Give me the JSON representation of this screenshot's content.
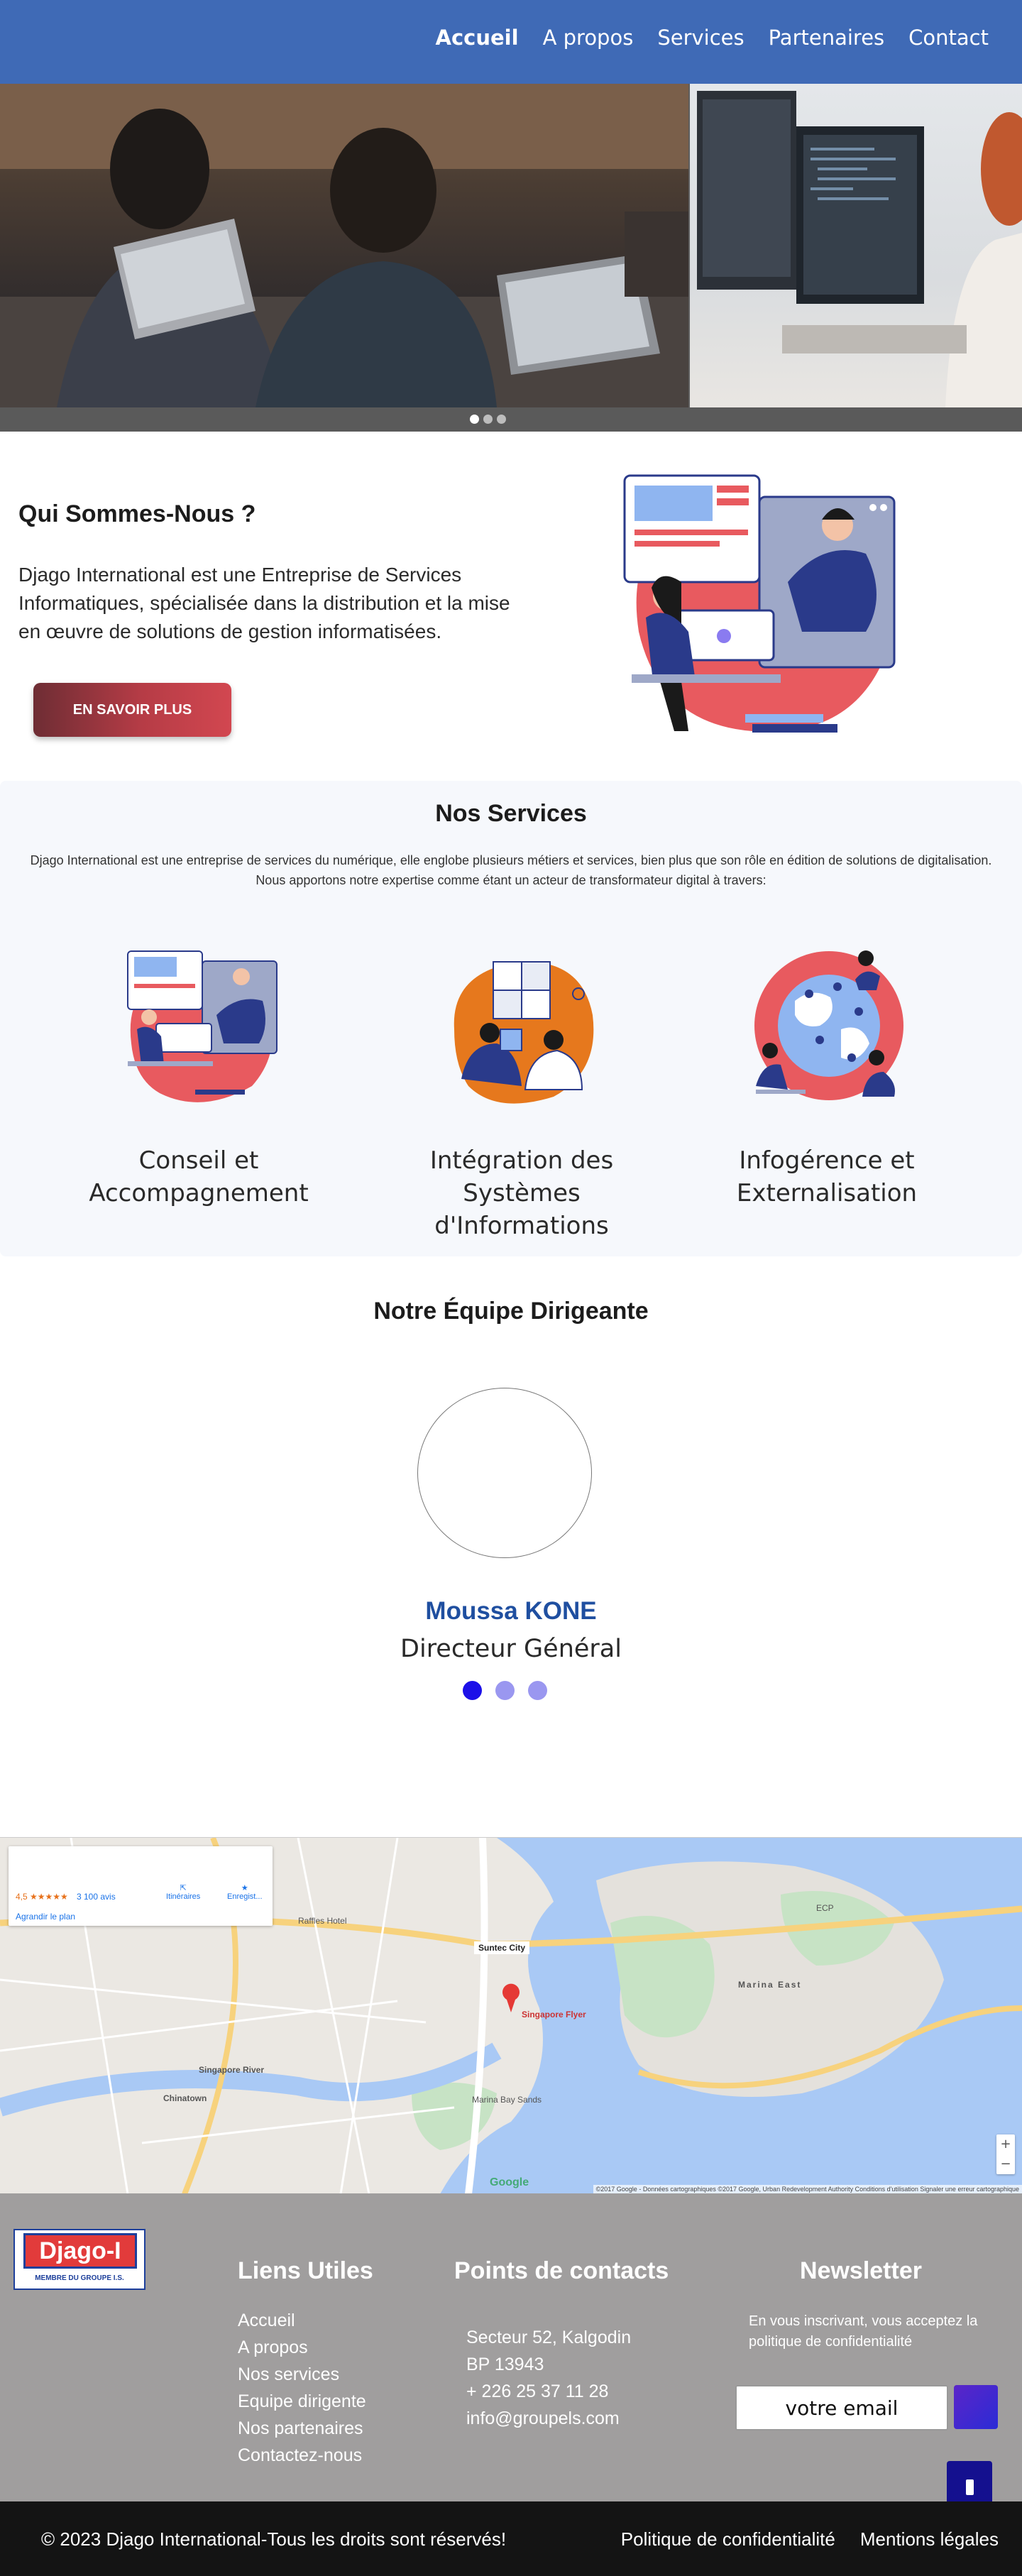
{
  "nav": {
    "items": [
      {
        "label": "Accueil",
        "active": true
      },
      {
        "label": "A propos",
        "active": false
      },
      {
        "label": "Services",
        "active": false
      },
      {
        "label": "Partenaires",
        "active": false
      },
      {
        "label": "Contact",
        "active": false
      }
    ],
    "bg_color": "#3f6ab6"
  },
  "hero": {
    "slide_count": 3,
    "active_slide": 1
  },
  "about": {
    "title": "Qui Sommes-Nous ?",
    "text": "Djago International est une Entreprise de Services Informatiques, spécialisée dans la distribution et la mise en œuvre de solutions de gestion informatisées.",
    "button_label": "EN SAVOIR PLUS"
  },
  "services": {
    "title": "Nos Services",
    "text": "Djago International est une entreprise de services du numérique, elle englobe plusieurs métiers et services, bien plus que son rôle en édition de solutions de digitalisation. Nous apportons notre expertise comme étant un acteur de transformateur digital à travers:",
    "items": [
      {
        "label": "Conseil et Accompagnement",
        "icon": "consulting-illustration-icon"
      },
      {
        "label": "Intégration des Systèmes d'Informations",
        "icon": "puzzle-illustration-icon"
      },
      {
        "label": "Infogérence et Externalisation",
        "icon": "globe-illustration-icon"
      }
    ]
  },
  "team": {
    "title": "Notre Équipe Dirigeante",
    "member": {
      "name": "Moussa KONE",
      "role": "Directeur Général"
    },
    "slide_count": 3,
    "active_slide": 1
  },
  "map": {
    "rating": "4,5 ★★★★★",
    "reviews": "3 100 avis",
    "enlarge": "Agrandir le plan",
    "directions": "Itinéraires",
    "save": "Enregist...",
    "pin_label": "Suntec City",
    "flyer_label": "Singapore Flyer",
    "labels": [
      "Raffles Hotel",
      "Marina East",
      "Marina Bay Sands",
      "Singapore River",
      "Chinatown",
      "ECP",
      "Singapore Flyer"
    ],
    "footer_text": "©2017 Google - Données cartographiques ©2017 Google, Urban Redevelopment Authority   Conditions d'utilisation   Signaler une erreur cartographique",
    "google": "Google"
  },
  "footer": {
    "logo_text": "Djago-I",
    "logo_sub": "MEMBRE DU GROUPE I.S.",
    "links_title": "Liens Utiles",
    "links": [
      "Accueil",
      "A propos",
      "Nos services",
      "Equipe dirigente",
      "Nos partenaires",
      "Contactez-nous"
    ],
    "contacts_title": "Points de contacts",
    "contacts": [
      "Secteur 52, Kalgodin",
      "BP 13943",
      "+ 226 25 37 11 28",
      "info@groupels.com"
    ],
    "newsletter_title": "Newsletter",
    "newsletter_text": "En vous inscrivant, vous acceptez la politique de confidentialité",
    "email_placeholder": "votre email",
    "bg_color": "#a09e9e"
  },
  "bottom": {
    "copyright": "© 2023 Djago International-Tous les droits sont réservés!",
    "links": [
      "Politique de confidentialité",
      "Mentions légales"
    ]
  }
}
